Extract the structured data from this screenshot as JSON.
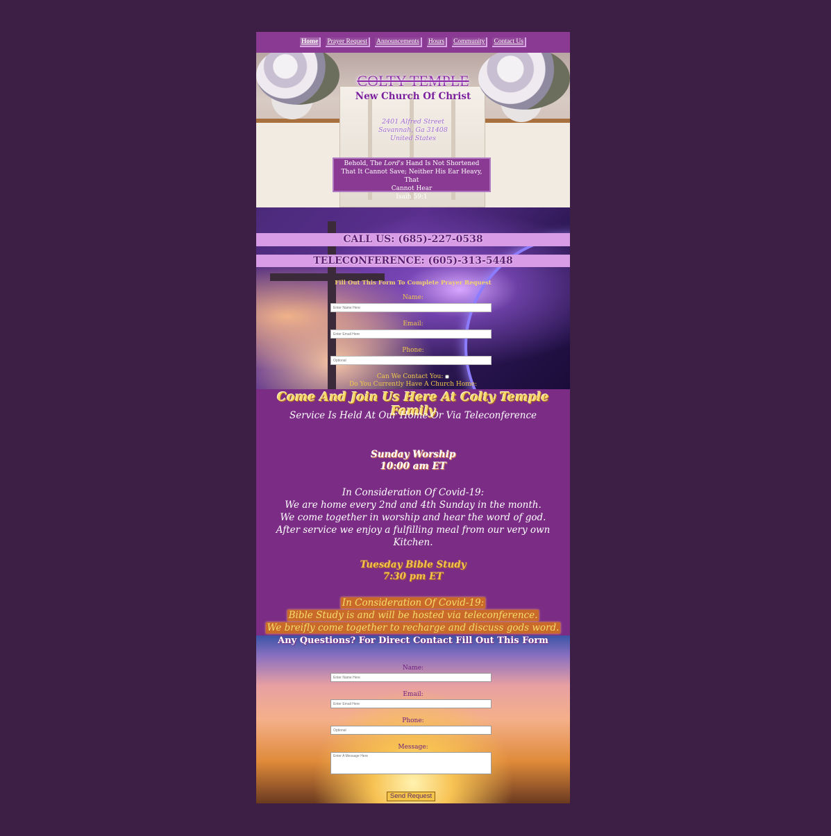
{
  "nav": {
    "items": [
      {
        "label": "Home",
        "active": true
      },
      {
        "label": "Prayer Request",
        "active": false
      },
      {
        "label": "Announcements",
        "active": false
      },
      {
        "label": "Hours",
        "active": false
      },
      {
        "label": "Community",
        "active": false
      },
      {
        "label": "Contact Us",
        "active": false
      }
    ]
  },
  "hero": {
    "title": "COLTY TEMPLE",
    "subtitle": "New Church Of Christ",
    "address": [
      "2401 Alfred Street",
      "Savannah, Ga 31408",
      "United States"
    ],
    "verse": {
      "line1_pre": "Behold, The ",
      "line1_em": "Lord's",
      "line1_post": " Hand Is Not Shortened",
      "line2": "That It Cannot Save; Neither His Ear Heavy, That",
      "line3": "Cannot Hear",
      "reference": "Isaih 59:1"
    }
  },
  "phones": {
    "call": "CALL US: (685)-227-0538",
    "teleconference": "TELECONFERENCE: (605)-313-5448"
  },
  "prayer_form": {
    "title": "Fill Out This Form To Complete Prayer Request",
    "name_label": "Name:",
    "name_placeholder": "Enter Name Here",
    "email_label": "Email:",
    "email_placeholder": "Enter Email Here",
    "phone_label": "Phone:",
    "phone_placeholder": "Optional",
    "contact_question": "Can We Contact You:",
    "church_question": "Do You Currently Have A Church Home:"
  },
  "service": {
    "title": "Come And Join Us Here At Colty Temple Family",
    "subtitle": "Service Is Held At Our Home Or Via Teleconference",
    "sunday_name": "Sunday Worship",
    "sunday_time": "10:00 am ET",
    "covid_title": "In Consideration Of Covid-19:",
    "covid_lines": [
      "We are home every 2nd and 4th Sunday in the month.",
      "We come together in worship and hear the word of god.",
      "After service we enjoy a fulfilling meal from our very own Kitchen."
    ],
    "tuesday_name": "Tuesday Bible Study",
    "tuesday_time": "7:30 pm ET",
    "bible_covid_title": "In Consideration Of Covid-19:",
    "bible_lines": [
      "Bible Study is and will be hosted via teleconference.",
      "We breifly come together to recharge and discuss gods word."
    ]
  },
  "contact_form": {
    "title": "Any Questions? For Direct Contact Fill Out This Form",
    "name_label": "Name:",
    "name_placeholder": "Enter Name Here",
    "email_label": "Email:",
    "email_placeholder": "Enter Email Here",
    "phone_label": "Phone:",
    "phone_placeholder": "Optional",
    "message_label": "Message:",
    "message_placeholder": "Enter A Message Here",
    "submit_label": "Send Request"
  },
  "colors": {
    "background": "#3d1f45",
    "page_purple": "#7b2d86",
    "nav_purple": "#8a3a92",
    "band_lavender": "#d89be6",
    "gold": "#f3c34b"
  }
}
